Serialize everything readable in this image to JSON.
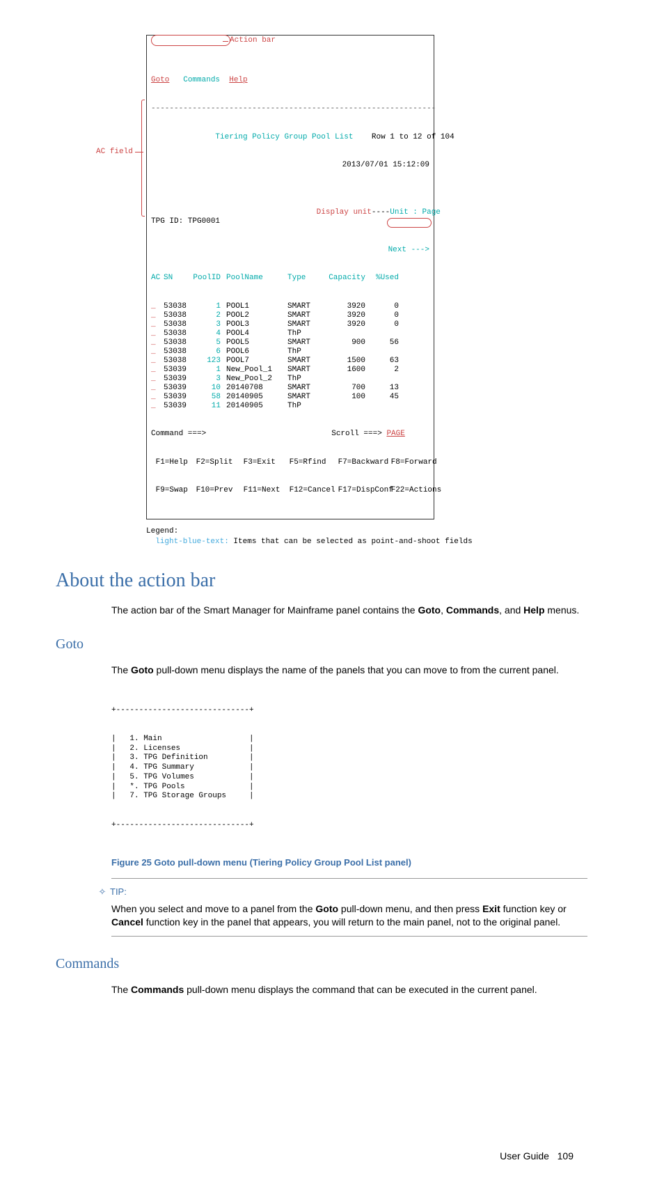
{
  "panel": {
    "actionbar": {
      "goto": "Goto",
      "commands": "Commands",
      "help": "Help",
      "label": "Action bar"
    },
    "title": "Tiering Policy Group Pool List",
    "rowinfo": "Row 1 to 12 of 104",
    "datetime": "2013/07/01 15:12:09",
    "display_unit": "Display unit",
    "unit_value": "Unit : Page",
    "tpg": "TPG ID: TPG0001",
    "next": "Next --->",
    "headers": {
      "ac": "AC",
      "sn": "SN",
      "poolid": "PoolID",
      "poolname": "PoolName",
      "type": "Type",
      "capacity": "Capacity",
      "used": "%Used"
    },
    "rows": [
      {
        "ac": "_",
        "sn": "53038",
        "pid": "1",
        "pname": "POOL1",
        "type": "SMART",
        "cap": "3920",
        "used": "0"
      },
      {
        "ac": "_",
        "sn": "53038",
        "pid": "2",
        "pname": "POOL2",
        "type": "SMART",
        "cap": "3920",
        "used": "0"
      },
      {
        "ac": "_",
        "sn": "53038",
        "pid": "3",
        "pname": "POOL3",
        "type": "SMART",
        "cap": "3920",
        "used": "0"
      },
      {
        "ac": "_",
        "sn": "53038",
        "pid": "4",
        "pname": "POOL4",
        "type": "ThP",
        "cap": "",
        "used": ""
      },
      {
        "ac": "_",
        "sn": "53038",
        "pid": "5",
        "pname": "POOL5",
        "type": "SMART",
        "cap": "900",
        "used": "56"
      },
      {
        "ac": "_",
        "sn": "53038",
        "pid": "6",
        "pname": "POOL6",
        "type": "ThP",
        "cap": "",
        "used": ""
      },
      {
        "ac": "_",
        "sn": "53038",
        "pid": "123",
        "pname": "POOL7",
        "type": "SMART",
        "cap": "1500",
        "used": "63"
      },
      {
        "ac": "_",
        "sn": "53039",
        "pid": "1",
        "pname": "New_Pool_1",
        "type": "SMART",
        "cap": "1600",
        "used": "2"
      },
      {
        "ac": "_",
        "sn": "53039",
        "pid": "3",
        "pname": "New_Pool_2",
        "type": "ThP",
        "cap": "",
        "used": ""
      },
      {
        "ac": "_",
        "sn": "53039",
        "pid": "10",
        "pname": "20140708",
        "type": "SMART",
        "cap": "700",
        "used": "13"
      },
      {
        "ac": "_",
        "sn": "53039",
        "pid": "58",
        "pname": "20140905",
        "type": "SMART",
        "cap": "100",
        "used": "45"
      },
      {
        "ac": "_",
        "sn": "53039",
        "pid": "11",
        "pname": "20140905",
        "type": "ThP",
        "cap": "",
        "used": ""
      }
    ],
    "command": "Command ===>",
    "scroll": "Scroll ===>",
    "scroll_val": "PAGE",
    "fkeys1": {
      "f1": "F1=Help",
      "f2": "F2=Split",
      "f3": "F3=Exit",
      "f5": "F5=Rfind",
      "f7": "F7=Backward",
      "f8": "F8=Forward"
    },
    "fkeys2": {
      "f9": "F9=Swap",
      "f10": "F10=Prev",
      "f11": "F11=Next",
      "f12": "F12=Cancel",
      "f17": "F17=DispConf",
      "f22": "F22=Actions"
    }
  },
  "callouts": {
    "ac_field": "AC field",
    "action_bar": "Action bar",
    "display_unit": "Display unit"
  },
  "legend": {
    "title": "Legend:",
    "item": "light-blue-text:",
    "desc": " Items that can be selected as point-and-shoot fields"
  },
  "headings": {
    "h_main": "About the action bar",
    "h_goto": "Goto",
    "h_cmd": "Commands"
  },
  "text": {
    "about_1a": "The action bar of the Smart Manager for Mainframe panel contains the ",
    "about_1_goto": "Goto",
    "about_1b": ", ",
    "about_1_cmd": "Commands",
    "about_1c": ", and ",
    "about_1_help": "Help",
    "about_1d": " menus.",
    "goto_1a": "The ",
    "goto_1_goto": "Goto",
    "goto_1b": " pull-down menu displays the name of the panels that you can move to from the current panel.",
    "cmd_1a": "The ",
    "cmd_1_cmd": "Commands",
    "cmd_1b": " pull-down menu displays the command that can be executed in the current panel."
  },
  "goto_menu": {
    "border_top": "+-----------------------------+",
    "items": [
      "|   1. Main                   |",
      "|   2. Licenses               |",
      "|   3. TPG Definition         |",
      "|   4. TPG Summary            |",
      "|   5. TPG Volumes            |",
      "|   *. TPG Pools              |",
      "|   7. TPG Storage Groups     |"
    ],
    "border_bot": "+-----------------------------+"
  },
  "fig25": "Figure 25 Goto pull-down menu (Tiering Policy Group Pool List panel)",
  "tip": {
    "head": "TIP:",
    "t1": "When you select and move to a panel from the ",
    "t_goto": "Goto",
    "t2": " pull-down menu, and then press ",
    "t_exit": "Exit",
    "t3": " function key or ",
    "t_cancel": "Cancel",
    "t4": " function key in the panel that appears, you will return to the main panel, not to the original panel."
  },
  "footer": {
    "label": "User Guide",
    "page": "109"
  }
}
